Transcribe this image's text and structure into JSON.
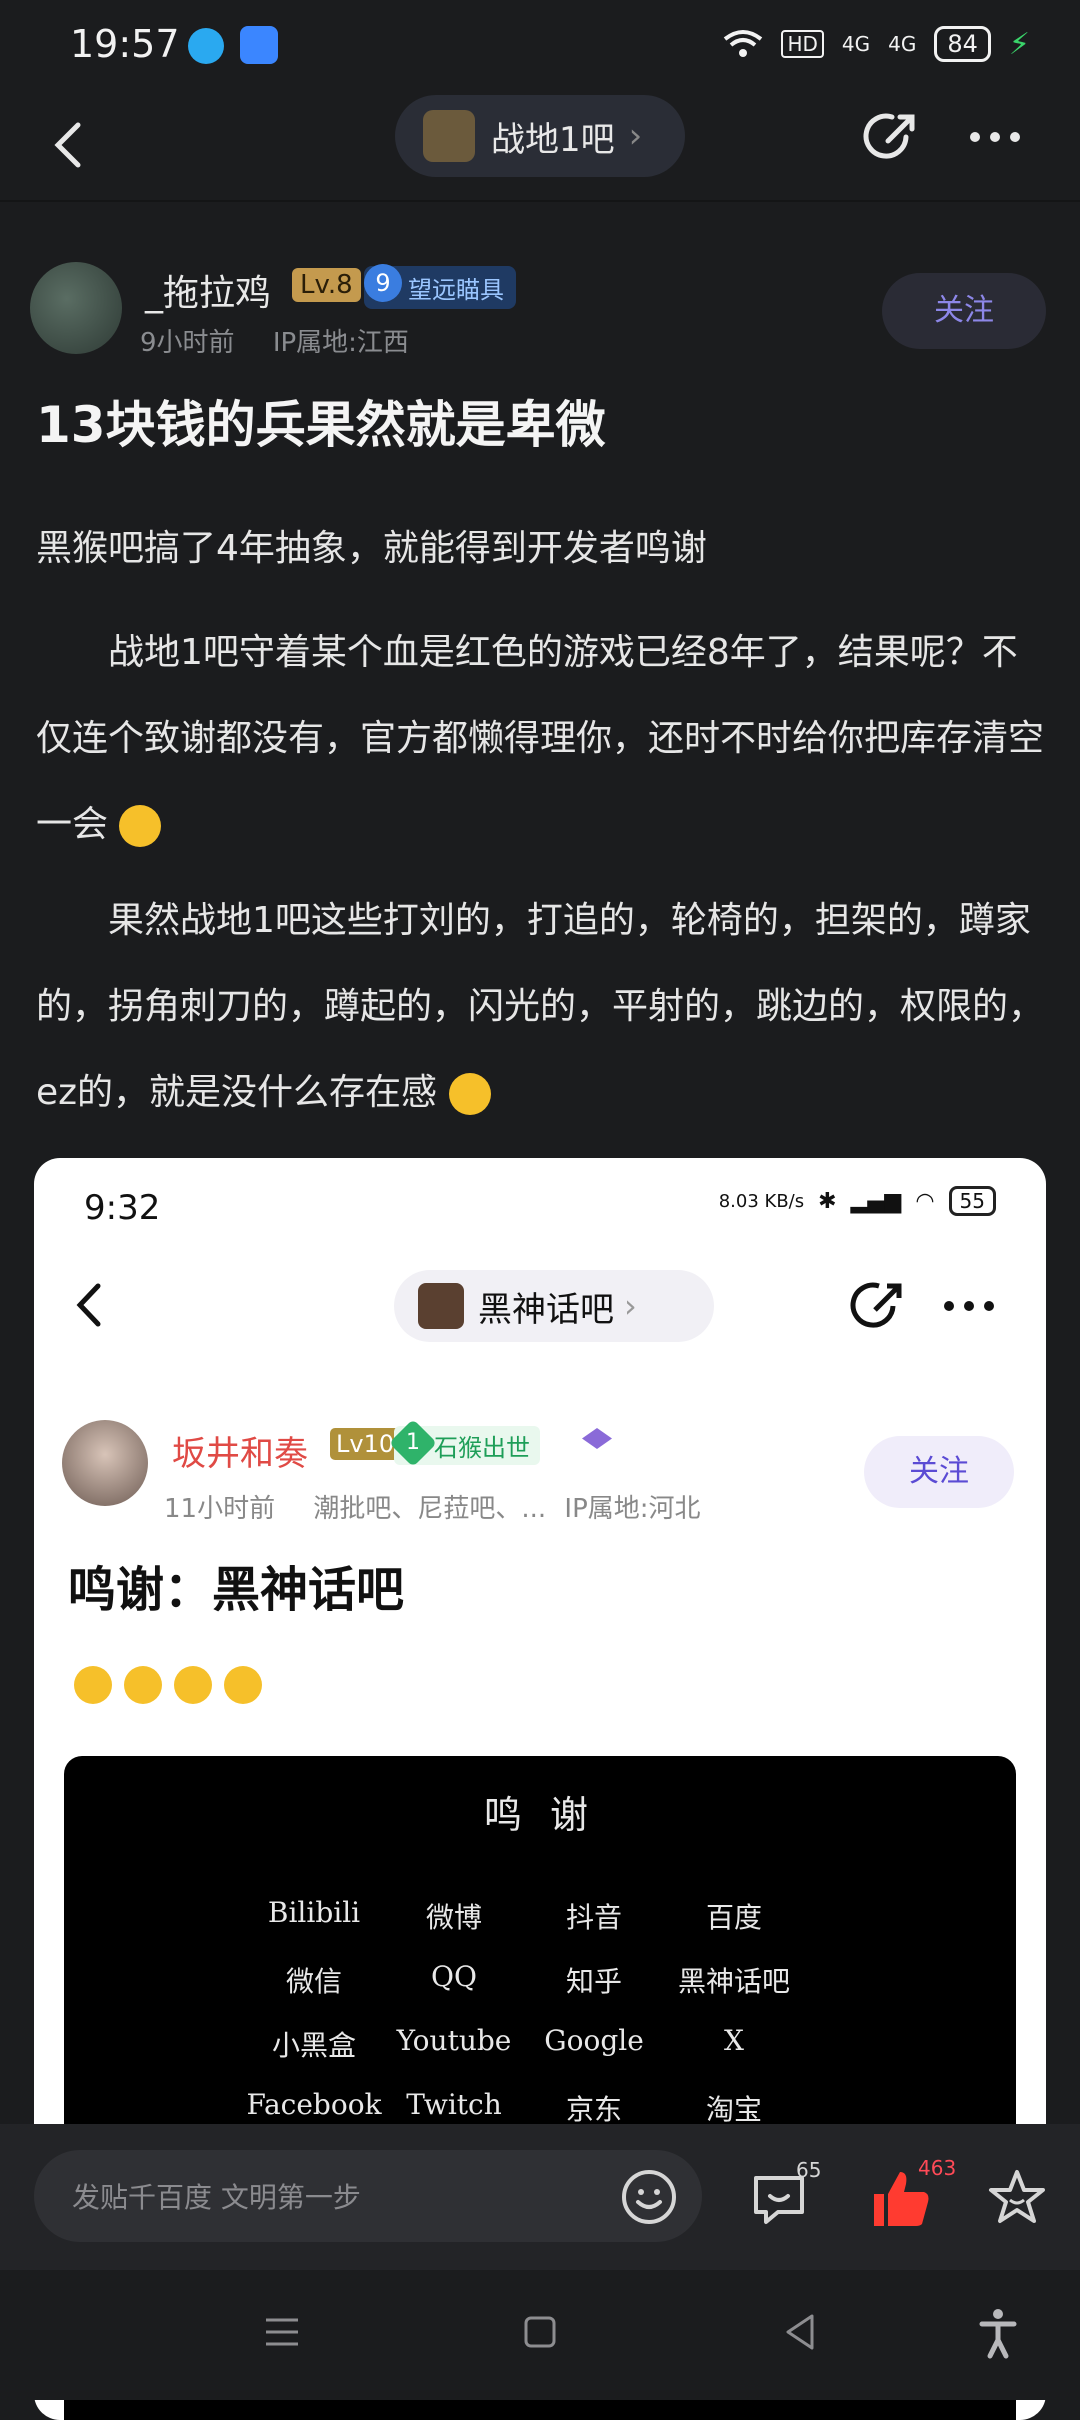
{
  "status_bar": {
    "time": "19:57",
    "network": "HD",
    "signal1": "4G",
    "signal2": "4G",
    "battery": "84"
  },
  "nav": {
    "forum_name": "战地1吧"
  },
  "post": {
    "author": "_拖拉鸡",
    "level": "Lv.8",
    "medal_num": "9",
    "medal": "望远瞄具",
    "time_ago": "9小时前",
    "ip": "IP属地:江西",
    "follow": "关注",
    "title": "13块钱的兵果然就是卑微",
    "p1": "黑猴吧搞了4年抽象，就能得到开发者鸣谢",
    "p2": "　　战地1吧守着某个血是红色的游戏已经8年了，结果呢？不仅连个致谢都没有，官方都懒得理你，还时不时给你把库存清空一会",
    "p3": "　　果然战地1吧这些打刘的，打追的，轮椅的，担架的，蹲家的，拐角刺刀的，蹲起的，闪光的，平射的，跳边的，权限的，ez的，就是没什么存在感"
  },
  "embed": {
    "time": "9:32",
    "speed": "8.03 KB/s",
    "battery": "55",
    "forum_name": "黑神话吧",
    "author": "坂井和奏",
    "level": "Lv10",
    "medal_num": "1",
    "medal": "石猴出世",
    "time_ago": "11小时前",
    "forums": "潮批吧、尼菈吧、...",
    "ip": "IP属地:河北",
    "follow": "关注",
    "title": "鸣谢：黑神话吧",
    "credits": {
      "heading": "鸣 谢",
      "items": [
        "Bilibili",
        "微博",
        "抖音",
        "百度",
        "微信",
        "QQ",
        "知乎",
        "黑神话吧",
        "小黑盒",
        "Youtube",
        "Google",
        "X",
        "Facebook",
        "Twitch",
        "京东",
        "淘宝"
      ]
    }
  },
  "bottom": {
    "reply_placeholder": "发贴千百度 文明第一步",
    "comment_count": "65",
    "like_count": "463"
  }
}
